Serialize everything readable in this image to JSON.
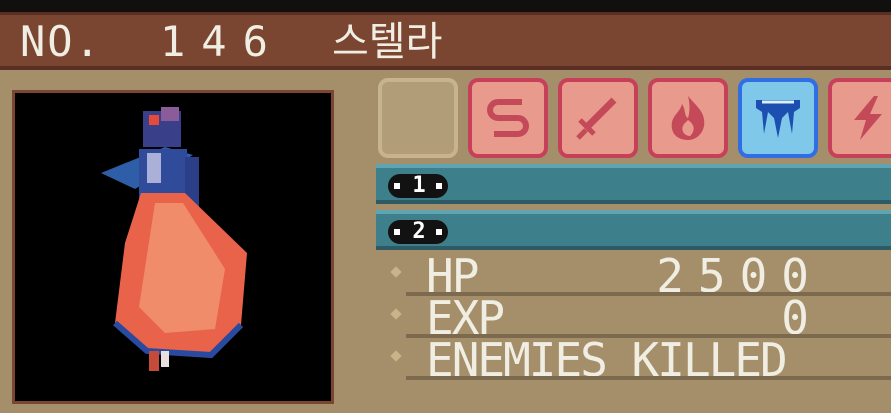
{
  "header": {
    "no_label": "NO.",
    "number": "146",
    "name": "스텔라"
  },
  "type_icons": [
    {
      "name": "empty-slot",
      "selected": false
    },
    {
      "name": "wind-icon",
      "selected": false
    },
    {
      "name": "sword-icon",
      "selected": false
    },
    {
      "name": "fire-icon",
      "selected": false
    },
    {
      "name": "ice-icon",
      "selected": true
    },
    {
      "name": "lightning-icon",
      "selected": false
    }
  ],
  "moves": [
    {
      "slot": "1",
      "name": ""
    },
    {
      "slot": "2",
      "name": ""
    }
  ],
  "stats": [
    {
      "label": "HP",
      "value": "2500"
    },
    {
      "label": "EXP",
      "value": "0"
    },
    {
      "label": "ENEMIES KILLED",
      "value": ""
    }
  ],
  "colors": {
    "title_bar": "#7a4632",
    "panel": "#a58f6a",
    "move_row": "#3e7f8c",
    "type_slot": "#e89a8c",
    "type_slot_selected": "#80c8ea"
  }
}
